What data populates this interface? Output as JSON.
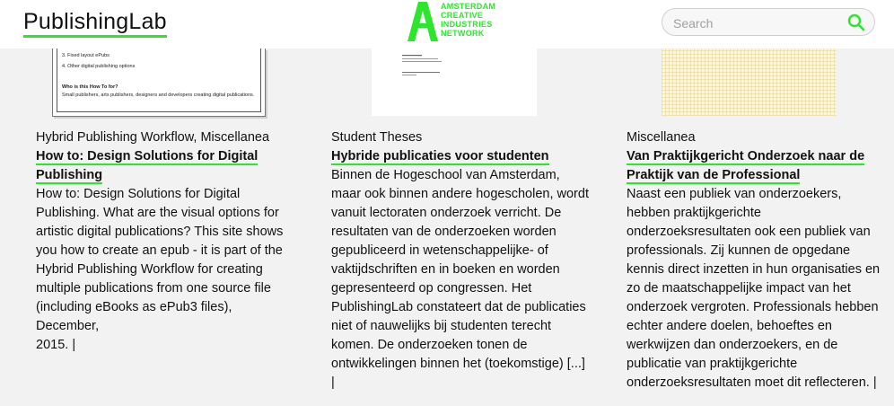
{
  "header": {
    "logo": "PublishingLab",
    "partner_logo_lines": [
      "AMSTERDAM",
      "CREATIVE",
      "INDUSTRIES",
      "NETWORK"
    ],
    "search": {
      "placeholder": "Search",
      "value": ""
    },
    "search_icon": "search-icon"
  },
  "colors": {
    "accent": "#2ee52e",
    "background": "#f2f2f2",
    "header": "#ffffff"
  },
  "thumb1_lines": [
    "3. Fixed layout ePubs",
    "4. Other digital publishing options",
    "Who is this How To for?",
    "Small publishers, arts publishers, designers and developers creating digital publications."
  ],
  "posts": [
    {
      "category": "Hybrid Publishing Workflow, Miscellanea",
      "title_lines": [
        "How to: Design Solutions for Digital",
        "Publishing"
      ],
      "excerpt_lines": [
        "How to: Design Solutions for Digital",
        "Publishing. What are the visual options for",
        "artistic digital publications? This site shows",
        "you how to create an epub - it is part of the",
        "Hybrid Publishing Workflow for creating",
        "multiple publications from one source file",
        "(including eBooks as ePub3 files), December,",
        "2015. |"
      ]
    },
    {
      "category": "Student Theses",
      "title_lines": [
        "Hybride publicaties voor studenten"
      ],
      "excerpt_lines": [
        "Binnen de Hogeschool van Amsterdam,",
        "maar ook binnen andere hogescholen, wordt",
        "vanuit lectoraten onderzoek verricht. De",
        "resultaten van de onderzoeken worden",
        "gepubliceerd in wetenschappelijke- of",
        "vaktijdschriften en in boeken en worden",
        "gepresenteerd op congressen. Het",
        "PublishingLab constateert dat de publicaties",
        "niet of nauwelijks bij studenten terecht",
        "komen. De onderzoeken tonen de",
        "ontwikkelingen binnen het (toekomstige) [...] |"
      ]
    },
    {
      "category": "Miscellanea",
      "title_lines": [
        "Van Praktijkgericht Onderzoek naar de",
        "Praktijk van de Professional"
      ],
      "excerpt_lines": [
        "Naast een publiek van onderzoekers,",
        "hebben praktijkgerichte",
        "onderzoeksresultaten ook een publiek van",
        "professionals. Zij kunnen de opgedane",
        "kennis direct inzetten in hun organisaties en",
        "zo de maatschappelijke impact van het",
        "onderzoek vergroten. Professionals hebben",
        "echter andere doelen, behoeftes en",
        "werkwijzen dan onderzoekers, en de",
        "publicatie van praktijkgerichte",
        "onderzoeksresultaten moet dit reflecteren. |"
      ]
    }
  ]
}
